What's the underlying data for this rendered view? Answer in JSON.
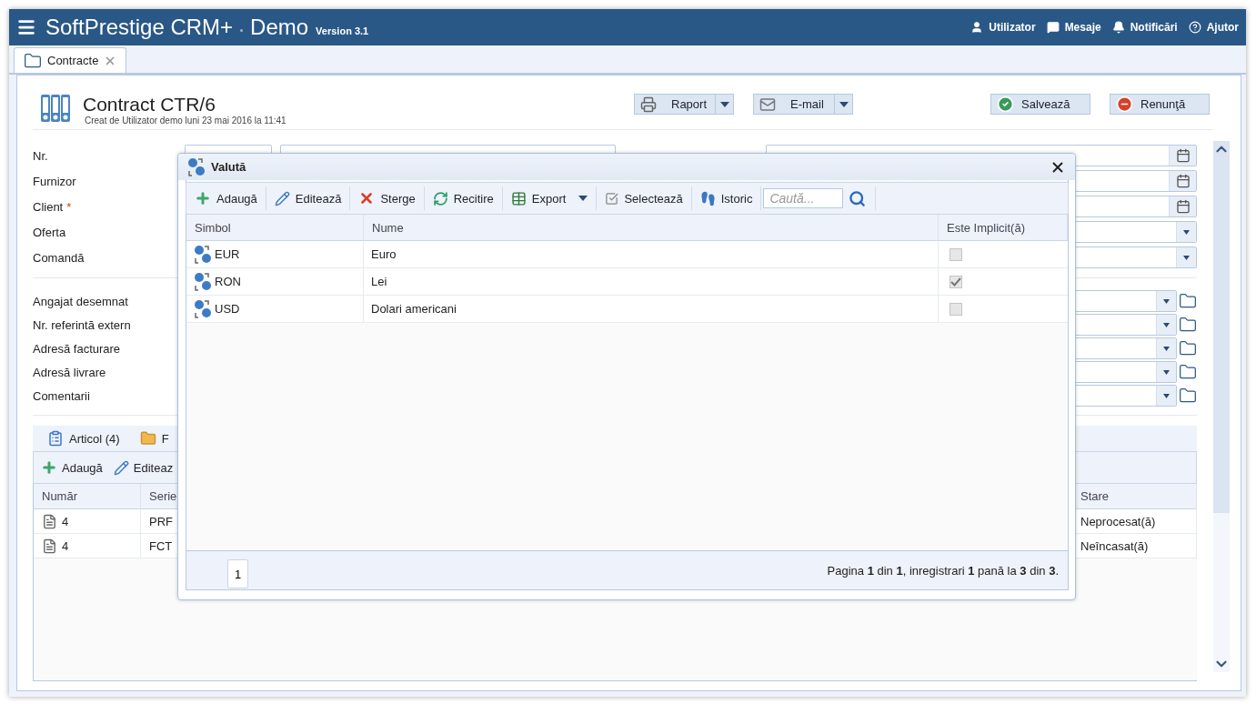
{
  "header": {
    "app_title": "SoftPrestige CRM+",
    "edition": "Demo",
    "version": "Version 3.1",
    "links": [
      {
        "label": "Utilizator",
        "kind": "user"
      },
      {
        "label": "Mesaje",
        "kind": "messages"
      },
      {
        "label": "Notificări",
        "kind": "bell"
      },
      {
        "label": "Ajutor",
        "kind": "help"
      }
    ]
  },
  "tabs": [
    {
      "label": "Contracte",
      "selected": true
    }
  ],
  "document": {
    "title": "Contract CTR/6",
    "subtitle": "Creat de Utilizator demo luni 23 mai 2016 la 11:41",
    "actions": [
      {
        "label": "Raport",
        "kind": "print",
        "split": true
      },
      {
        "label": "E-mail",
        "kind": "mail",
        "split": true
      },
      {
        "label": "Salvează",
        "kind": "save",
        "split": false
      },
      {
        "label": "Renunţă",
        "kind": "cancel",
        "split": false
      }
    ]
  },
  "form": {
    "upper_rows": [
      {
        "label": "Nr.",
        "kind": "date"
      },
      {
        "label": "Furnizor",
        "kind": "date"
      },
      {
        "label": "Client",
        "required_mark": "*",
        "kind": "date"
      },
      {
        "label": "Oferta",
        "kind": "select"
      },
      {
        "label": "Comandă",
        "kind": "select"
      }
    ],
    "lower_rows": [
      {
        "label": "Angajat desemnat"
      },
      {
        "label": "Nr. referintă extern"
      },
      {
        "label": "Adresă facturare"
      },
      {
        "label": "Adresă livrare"
      },
      {
        "label": "Comentarii"
      }
    ]
  },
  "detail_tabs": [
    {
      "label": "Articol (4)",
      "kind": "list"
    },
    {
      "label": "F",
      "kind": "folder"
    }
  ],
  "detail_toolbar": [
    {
      "label": "Adaugă",
      "kind": "add"
    },
    {
      "label": "Editeaz",
      "kind": "edit"
    }
  ],
  "detail_table": {
    "columns": [
      "Număr",
      "Serie",
      "Stare"
    ],
    "rows": [
      {
        "number": "4",
        "series": "PRF",
        "status": "Neprocesat(ă)"
      },
      {
        "number": "4",
        "series": "FCT",
        "status": "Neîncasat(ă)"
      }
    ]
  },
  "dialog": {
    "title": "Valută",
    "toolbar": [
      {
        "label": "Adaugă",
        "kind": "add"
      },
      {
        "label": "Editează",
        "kind": "edit"
      },
      {
        "label": "Sterge",
        "kind": "delete"
      },
      {
        "label": "Recitire",
        "kind": "refresh"
      },
      {
        "label": "Export",
        "kind": "export"
      },
      {
        "label": "Selectează",
        "kind": "select"
      },
      {
        "label": "Istoric",
        "kind": "history"
      }
    ],
    "search": {
      "placeholder": "Caută..."
    },
    "columns": [
      "Simbol",
      "Nume",
      "Este Implicit(ă)"
    ],
    "rows": [
      {
        "symbol": "EUR",
        "name": "Euro",
        "default": false
      },
      {
        "symbol": "RON",
        "name": "Lei",
        "default": true
      },
      {
        "symbol": "USD",
        "name": "Dolari americani",
        "default": false
      }
    ],
    "pager": {
      "page": "1",
      "summary": "Pagina **1** din **1**, inregistrari **1** pană la **3** din **3**."
    }
  }
}
